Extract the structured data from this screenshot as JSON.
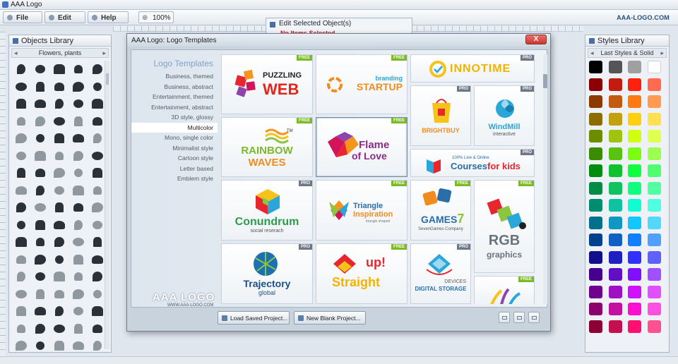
{
  "window": {
    "title": "AAA Logo"
  },
  "menu": {
    "file": "File",
    "edit": "Edit",
    "help": "Help",
    "zoom": "100%"
  },
  "brand_url": "AAA-LOGO.COM",
  "objects_library": {
    "title": "Objects Library",
    "category": "Flowers, plants"
  },
  "styles_library": {
    "title": "Styles Library",
    "category": "Last Styles & Solid",
    "swatches": [
      "#000000",
      "#555555",
      "#a0a0a0",
      "#ffffff",
      "#8b0000",
      "#c21b10",
      "#ff2010",
      "#ff6a50",
      "#8c3a00",
      "#c25a10",
      "#ff7a10",
      "#ff9a50",
      "#8c6e00",
      "#c2a010",
      "#ffd010",
      "#ffe050",
      "#6e8c00",
      "#a0c210",
      "#d0ff10",
      "#e0ff50",
      "#3a8c00",
      "#5ac210",
      "#7aff10",
      "#9aff50",
      "#008c10",
      "#10c230",
      "#10ff40",
      "#50ff70",
      "#008c45",
      "#10c260",
      "#10ff80",
      "#50ffa0",
      "#008c6e",
      "#10c2a0",
      "#10ffd0",
      "#50ffe0",
      "#00708c",
      "#1098c2",
      "#10c8ff",
      "#50d8ff",
      "#00408c",
      "#1060c2",
      "#1080ff",
      "#50a0ff",
      "#10108c",
      "#2020c2",
      "#3030ff",
      "#6060ff",
      "#45008c",
      "#6010c2",
      "#8010ff",
      "#a050ff",
      "#6e008c",
      "#a010c2",
      "#d010ff",
      "#e050ff",
      "#8c006e",
      "#c210a0",
      "#ff10d0",
      "#ff50e0",
      "#8c0035",
      "#c21050",
      "#ff1070",
      "#ff5090"
    ]
  },
  "edit_panel": {
    "title": "Edit Selected Object(s)",
    "status": "No Items Selected"
  },
  "dialog": {
    "title": "AAA Logo: Logo Templates",
    "close": "X",
    "nav_title": "Logo Templates",
    "nav_items": [
      "Business, themed",
      "Business, abstract",
      "Entertainment, themed",
      "Entertainment, abstract",
      "3D style, glossy",
      "Multicolor",
      "Mono, single color",
      "Minimalist style",
      "Cartoon style",
      "Letter based",
      "Emblem style"
    ],
    "active_index": 5,
    "brand_logo": "AAA LOGO",
    "brand_site": "WWW.AAA-LOGO.COM",
    "load_button": "Load Saved Project...",
    "new_button": "New Blank Project...",
    "templates": [
      {
        "name": "PUZZLING",
        "name2": "WEB",
        "badge": "FREE"
      },
      {
        "name": "branding",
        "name2": "STARTUP",
        "badge": "FREE"
      },
      {
        "name": "INNOTIME",
        "badge": "PRO"
      },
      {
        "name": "BRIGHTBUY",
        "badge": "PRO"
      },
      {
        "name": "WindMill",
        "sub": "interactive",
        "badge": "PRO"
      },
      {
        "name": "RAINBOW",
        "name2": "WAVES",
        "tm": "TM",
        "badge": "FREE"
      },
      {
        "name": "Flame",
        "name2": "of Love",
        "badge": "FREE"
      },
      {
        "name": "Courses",
        "name2": "for kids",
        "sub": "100% Live & Online",
        "badge": "PRO"
      },
      {
        "name": "Conundrum",
        "sub": "social reserach",
        "badge": "PRO"
      },
      {
        "name": "Triangle",
        "name2": "Inspiration",
        "sub": "triangle shaped",
        "badge": "FREE"
      },
      {
        "name": "GAMES",
        "name2": "7",
        "sub": "SevenGames Company",
        "badge": "FREE"
      },
      {
        "name": "RGB",
        "name2": "graphics",
        "badge": "FREE"
      },
      {
        "name": "Trajectory",
        "sub": "global",
        "badge": "PRO"
      },
      {
        "name": "Straight",
        "name2": "up!",
        "badge": "FREE"
      },
      {
        "name": "DIGITAL STORAGE",
        "sub": "DEVICES",
        "badge": "PRO"
      },
      {
        "badge": "FREE"
      }
    ]
  }
}
